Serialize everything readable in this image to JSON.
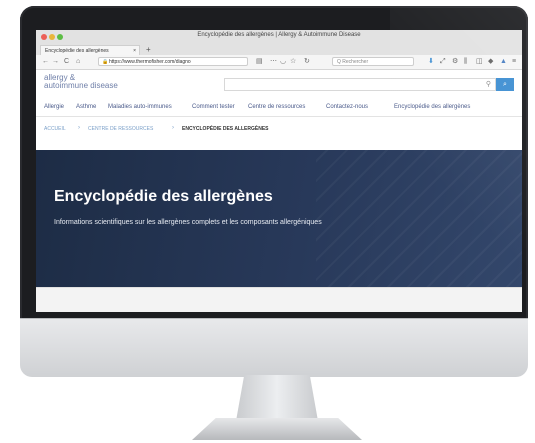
{
  "browser": {
    "window_title": "Encyclopédie des allergènes | Allergy & Autoimmune Disease",
    "tab_label": "Encyclopédie des allergènes",
    "tab_close": "×",
    "new_tab": "+",
    "url": "https://www.thermofisher.com/diagno",
    "search_placeholder": "Q  Rechercher",
    "icons": {
      "back": "←",
      "forward": "→",
      "home": "⌂",
      "reload": "C",
      "menu": "≡"
    }
  },
  "site": {
    "logo": {
      "line1": "allergy &",
      "line2": "autoimmune disease"
    },
    "search_icon": "⚲",
    "search_button": "⌕",
    "nav": [
      "Allergie",
      "Asthme",
      "Maladies auto-immunes",
      "Comment tester",
      "Centre de ressources",
      "Contactez-nous",
      "Encyclopédie des allergènes"
    ],
    "breadcrumb": [
      "ACCUEIL",
      "CENTRE DE RESSOURCES",
      "ENCYCLOPÉDIE DES ALLERGÈNES"
    ],
    "breadcrumb_sep": "›",
    "hero": {
      "title": "Encyclopédie des allergènes",
      "subtitle": "Informations scientifiques sur les allergènes complets et les composants allergéniques"
    }
  },
  "colors": {
    "accent": "#3f8fd2",
    "nav_text": "#4a5a8a",
    "hero_bg": "#1d2c45"
  }
}
